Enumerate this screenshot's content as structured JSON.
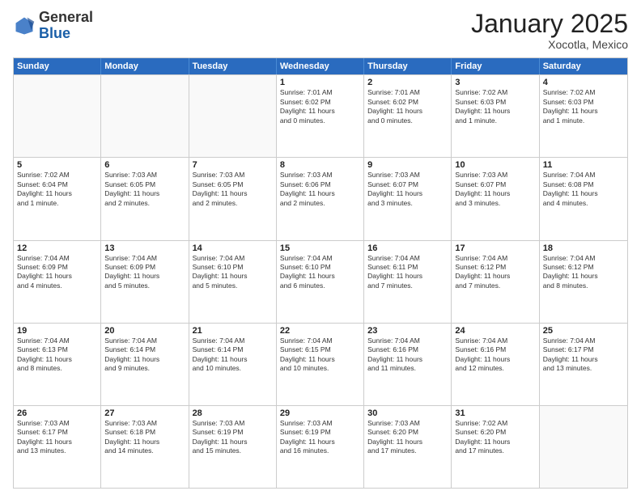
{
  "logo": {
    "general": "General",
    "blue": "Blue"
  },
  "title": "January 2025",
  "location": "Xocotla, Mexico",
  "days_of_week": [
    "Sunday",
    "Monday",
    "Tuesday",
    "Wednesday",
    "Thursday",
    "Friday",
    "Saturday"
  ],
  "weeks": [
    [
      {
        "num": "",
        "info": ""
      },
      {
        "num": "",
        "info": ""
      },
      {
        "num": "",
        "info": ""
      },
      {
        "num": "1",
        "info": "Sunrise: 7:01 AM\nSunset: 6:02 PM\nDaylight: 11 hours\nand 0 minutes."
      },
      {
        "num": "2",
        "info": "Sunrise: 7:01 AM\nSunset: 6:02 PM\nDaylight: 11 hours\nand 0 minutes."
      },
      {
        "num": "3",
        "info": "Sunrise: 7:02 AM\nSunset: 6:03 PM\nDaylight: 11 hours\nand 1 minute."
      },
      {
        "num": "4",
        "info": "Sunrise: 7:02 AM\nSunset: 6:03 PM\nDaylight: 11 hours\nand 1 minute."
      }
    ],
    [
      {
        "num": "5",
        "info": "Sunrise: 7:02 AM\nSunset: 6:04 PM\nDaylight: 11 hours\nand 1 minute."
      },
      {
        "num": "6",
        "info": "Sunrise: 7:03 AM\nSunset: 6:05 PM\nDaylight: 11 hours\nand 2 minutes."
      },
      {
        "num": "7",
        "info": "Sunrise: 7:03 AM\nSunset: 6:05 PM\nDaylight: 11 hours\nand 2 minutes."
      },
      {
        "num": "8",
        "info": "Sunrise: 7:03 AM\nSunset: 6:06 PM\nDaylight: 11 hours\nand 2 minutes."
      },
      {
        "num": "9",
        "info": "Sunrise: 7:03 AM\nSunset: 6:07 PM\nDaylight: 11 hours\nand 3 minutes."
      },
      {
        "num": "10",
        "info": "Sunrise: 7:03 AM\nSunset: 6:07 PM\nDaylight: 11 hours\nand 3 minutes."
      },
      {
        "num": "11",
        "info": "Sunrise: 7:04 AM\nSunset: 6:08 PM\nDaylight: 11 hours\nand 4 minutes."
      }
    ],
    [
      {
        "num": "12",
        "info": "Sunrise: 7:04 AM\nSunset: 6:09 PM\nDaylight: 11 hours\nand 4 minutes."
      },
      {
        "num": "13",
        "info": "Sunrise: 7:04 AM\nSunset: 6:09 PM\nDaylight: 11 hours\nand 5 minutes."
      },
      {
        "num": "14",
        "info": "Sunrise: 7:04 AM\nSunset: 6:10 PM\nDaylight: 11 hours\nand 5 minutes."
      },
      {
        "num": "15",
        "info": "Sunrise: 7:04 AM\nSunset: 6:10 PM\nDaylight: 11 hours\nand 6 minutes."
      },
      {
        "num": "16",
        "info": "Sunrise: 7:04 AM\nSunset: 6:11 PM\nDaylight: 11 hours\nand 7 minutes."
      },
      {
        "num": "17",
        "info": "Sunrise: 7:04 AM\nSunset: 6:12 PM\nDaylight: 11 hours\nand 7 minutes."
      },
      {
        "num": "18",
        "info": "Sunrise: 7:04 AM\nSunset: 6:12 PM\nDaylight: 11 hours\nand 8 minutes."
      }
    ],
    [
      {
        "num": "19",
        "info": "Sunrise: 7:04 AM\nSunset: 6:13 PM\nDaylight: 11 hours\nand 8 minutes."
      },
      {
        "num": "20",
        "info": "Sunrise: 7:04 AM\nSunset: 6:14 PM\nDaylight: 11 hours\nand 9 minutes."
      },
      {
        "num": "21",
        "info": "Sunrise: 7:04 AM\nSunset: 6:14 PM\nDaylight: 11 hours\nand 10 minutes."
      },
      {
        "num": "22",
        "info": "Sunrise: 7:04 AM\nSunset: 6:15 PM\nDaylight: 11 hours\nand 10 minutes."
      },
      {
        "num": "23",
        "info": "Sunrise: 7:04 AM\nSunset: 6:16 PM\nDaylight: 11 hours\nand 11 minutes."
      },
      {
        "num": "24",
        "info": "Sunrise: 7:04 AM\nSunset: 6:16 PM\nDaylight: 11 hours\nand 12 minutes."
      },
      {
        "num": "25",
        "info": "Sunrise: 7:04 AM\nSunset: 6:17 PM\nDaylight: 11 hours\nand 13 minutes."
      }
    ],
    [
      {
        "num": "26",
        "info": "Sunrise: 7:03 AM\nSunset: 6:17 PM\nDaylight: 11 hours\nand 13 minutes."
      },
      {
        "num": "27",
        "info": "Sunrise: 7:03 AM\nSunset: 6:18 PM\nDaylight: 11 hours\nand 14 minutes."
      },
      {
        "num": "28",
        "info": "Sunrise: 7:03 AM\nSunset: 6:19 PM\nDaylight: 11 hours\nand 15 minutes."
      },
      {
        "num": "29",
        "info": "Sunrise: 7:03 AM\nSunset: 6:19 PM\nDaylight: 11 hours\nand 16 minutes."
      },
      {
        "num": "30",
        "info": "Sunrise: 7:03 AM\nSunset: 6:20 PM\nDaylight: 11 hours\nand 17 minutes."
      },
      {
        "num": "31",
        "info": "Sunrise: 7:02 AM\nSunset: 6:20 PM\nDaylight: 11 hours\nand 17 minutes."
      },
      {
        "num": "",
        "info": ""
      }
    ]
  ]
}
